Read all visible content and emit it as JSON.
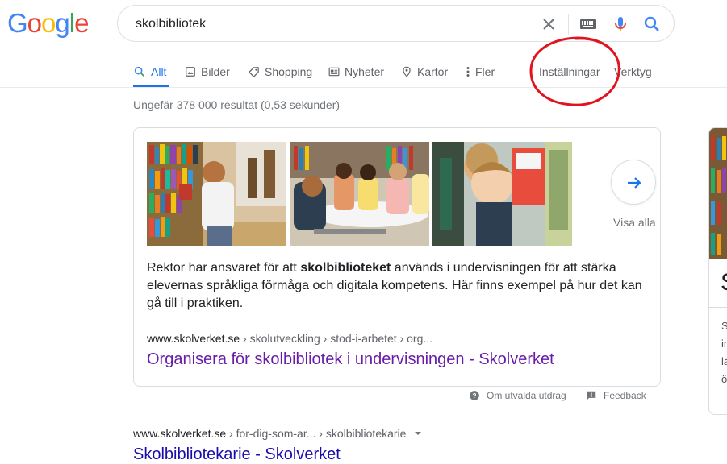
{
  "logo": {
    "text": "Google",
    "letters": [
      {
        "ch": "G",
        "color": "#4285F4"
      },
      {
        "ch": "o",
        "color": "#EA4335"
      },
      {
        "ch": "o",
        "color": "#FBBC05"
      },
      {
        "ch": "g",
        "color": "#4285F4"
      },
      {
        "ch": "l",
        "color": "#34A853"
      },
      {
        "ch": "e",
        "color": "#EA4335"
      }
    ]
  },
  "search": {
    "query": "skolbibliotek"
  },
  "icons": {
    "clear": "close-icon",
    "keyboard": "keyboard-icon",
    "voice": "microphone-icon",
    "search": "search-icon"
  },
  "tabs": [
    {
      "label": "Allt",
      "icon": "search-icon",
      "active": true
    },
    {
      "label": "Bilder",
      "icon": "image-icon"
    },
    {
      "label": "Shopping",
      "icon": "tag-icon"
    },
    {
      "label": "Nyheter",
      "icon": "newspaper-icon"
    },
    {
      "label": "Kartor",
      "icon": "map-pin-icon"
    },
    {
      "label": "Fler",
      "icon": "more-vert-icon"
    },
    {
      "label": "Inställningar"
    },
    {
      "label": "Verktyg"
    }
  ],
  "result_stats": "Ungefär 378 000 resultat (0,53 sekunder)",
  "featured": {
    "visa_alla": "Visa alla",
    "snippet_pre": "Rektor har ansvaret för att ",
    "snippet_bold": "skolbiblioteket",
    "snippet_post": " används i undervisningen för att stärka elevernas språkliga förmåga och digitala kompetens. Här finns exempel på hur det kan gå till i praktiken.",
    "cite_domain": "www.skolverket.se",
    "cite_path": " › skolutveckling › stod-i-arbetet › org...",
    "title": "Organisera för skolbibliotek i undervisningen - Skolverket"
  },
  "feedback": {
    "about": "Om utvalda utdrag",
    "feedback": "Feedback"
  },
  "result2": {
    "cite_domain": "www.skolverket.se",
    "cite_path": " › for-dig-som-ar... › skolbibliotekarie",
    "title": "Skolbibliotekarie - Skolverket"
  },
  "right_panel": {
    "heading_char": "S",
    "lines": [
      "S",
      "ir",
      "lä",
      "ö"
    ]
  },
  "colors": {
    "accent": "#1a73e8",
    "visited_link": "#681da8",
    "link": "#1a0dab",
    "annotation": "#e0141e"
  }
}
